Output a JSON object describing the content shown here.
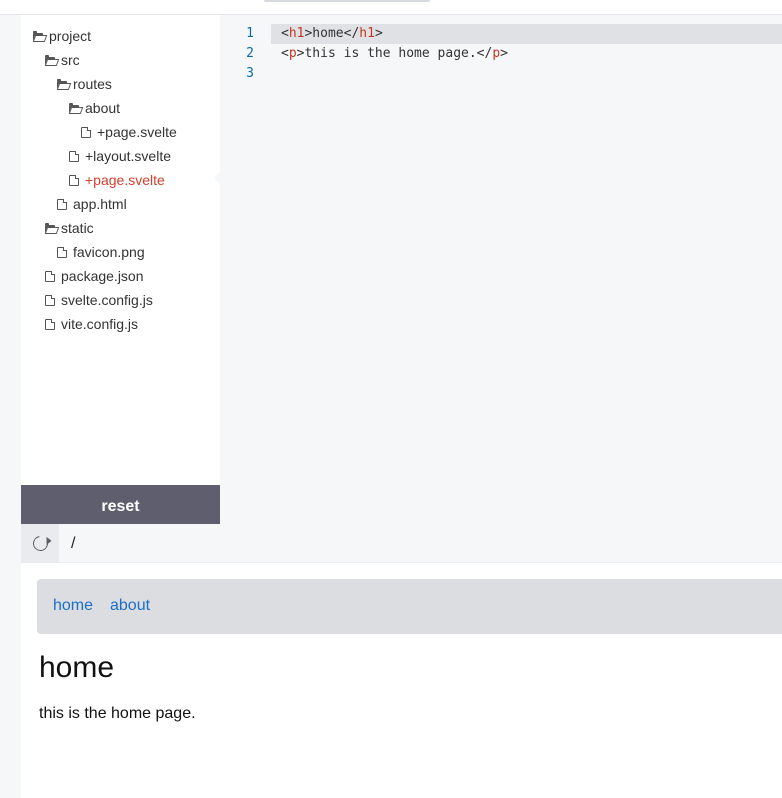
{
  "file_tree": [
    {
      "name": "project",
      "type": "folder",
      "depth": 0
    },
    {
      "name": "src",
      "type": "folder",
      "depth": 1
    },
    {
      "name": "routes",
      "type": "folder",
      "depth": 2
    },
    {
      "name": "about",
      "type": "folder",
      "depth": 3
    },
    {
      "name": "+page.svelte",
      "type": "file",
      "depth": 4
    },
    {
      "name": "+layout.svelte",
      "type": "file",
      "depth": 3
    },
    {
      "name": "+page.svelte",
      "type": "file",
      "depth": 3,
      "active": true
    },
    {
      "name": "app.html",
      "type": "file",
      "depth": 2
    },
    {
      "name": "static",
      "type": "folder",
      "depth": 1
    },
    {
      "name": "favicon.png",
      "type": "file",
      "depth": 2
    },
    {
      "name": "package.json",
      "type": "file",
      "depth": 1
    },
    {
      "name": "svelte.config.js",
      "type": "file",
      "depth": 1
    },
    {
      "name": "vite.config.js",
      "type": "file",
      "depth": 1
    }
  ],
  "sidebar": {
    "reset_label": "reset"
  },
  "editor": {
    "lines": [
      {
        "number": "1",
        "current": true,
        "tokens": [
          [
            "p",
            "<"
          ],
          [
            "t",
            "h1"
          ],
          [
            "p",
            ">home</"
          ],
          [
            "t",
            "h1"
          ],
          [
            "p",
            ">"
          ]
        ]
      },
      {
        "number": "2",
        "current": false,
        "tokens": [
          [
            "p",
            "<"
          ],
          [
            "t",
            "p"
          ],
          [
            "p",
            ">this is the home page.</"
          ],
          [
            "t",
            "p"
          ],
          [
            "p",
            ">"
          ]
        ]
      },
      {
        "number": "3",
        "current": false,
        "tokens": []
      }
    ]
  },
  "preview_bar": {
    "url": "/"
  },
  "preview": {
    "nav": {
      "home_label": "home",
      "about_label": "about"
    },
    "heading": "home",
    "paragraph": "this is the home page."
  },
  "colors": {
    "accent_active_file": "#d3402c",
    "link": "#1a6fc9",
    "line_number": "#0a6ba8",
    "reset_button": "#5e5e6e"
  },
  "icons": {
    "folder": "folder-icon",
    "file": "file-icon",
    "refresh": "refresh-icon"
  }
}
